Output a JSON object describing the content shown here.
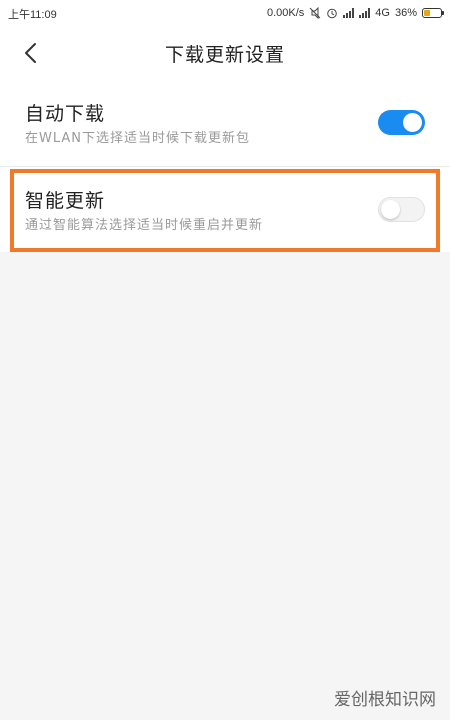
{
  "status_bar": {
    "time": "上午11:09",
    "net_speed": "0.00K/s",
    "network": "4G",
    "battery_percent": "36%",
    "battery_level": 0.36
  },
  "header": {
    "title": "下载更新设置",
    "back_icon": "chevron-left-icon"
  },
  "settings": [
    {
      "title": "自动下载",
      "subtitle": "在WLAN下选择适当时候下载更新包",
      "enabled": true
    },
    {
      "title": "智能更新",
      "subtitle": "通过智能算法选择适当时候重启并更新",
      "enabled": false
    }
  ],
  "colors": {
    "toggle_on": "#1a8bf0",
    "highlight": "#f07a2a",
    "battery": "#e8a317"
  },
  "watermark": "爱创根知识网"
}
